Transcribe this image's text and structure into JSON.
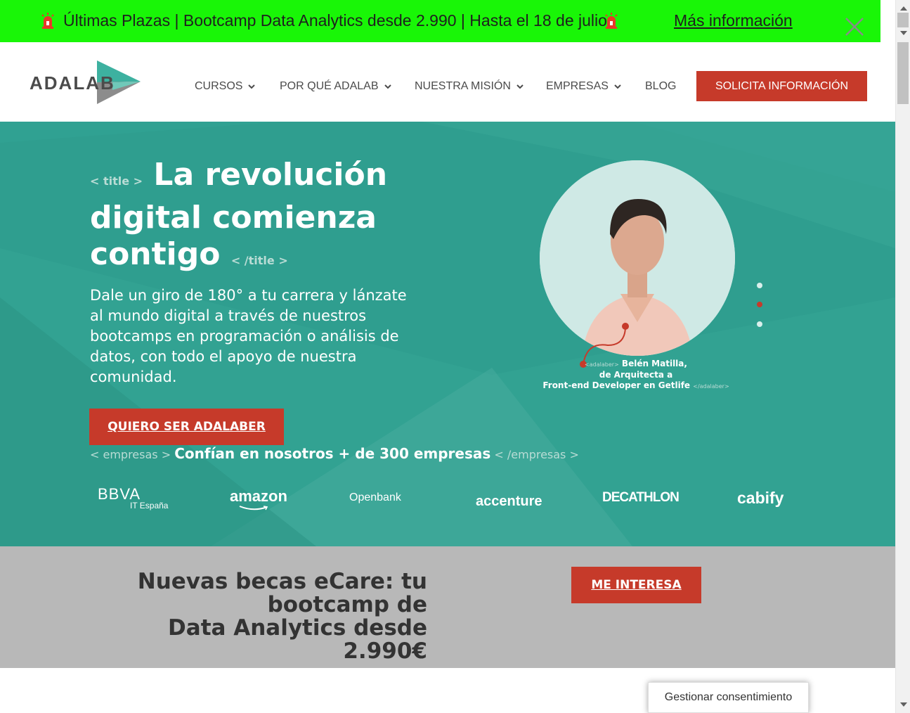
{
  "promo": {
    "text": "Últimas Plazas | Bootcamp Data Analytics desde 2.990 | Hasta el 18 de julio",
    "link": "Más información",
    "icons": [
      "siren-icon",
      "siren-icon",
      "close-icon"
    ],
    "background": "#19f607"
  },
  "header": {
    "logo": "ADALAB",
    "nav": [
      {
        "label": "CURSOS",
        "dropdown": true
      },
      {
        "label": "POR QUÉ ADALAB",
        "dropdown": true
      },
      {
        "label": "NUESTRA MISIÓN",
        "dropdown": true
      },
      {
        "label": "EMPRESAS",
        "dropdown": true
      },
      {
        "label": "BLOG",
        "dropdown": false
      }
    ],
    "cta": "SOLICITA INFORMACIÓN"
  },
  "hero": {
    "tag_open": "< title >",
    "title": "La revolución digital comienza contigo",
    "tag_close": "< /title >",
    "description": "Dale un giro de 180° a tu carrera y lánzate al mundo digital a través de nuestros bootcamps en programación o análisis de datos, con todo el apoyo de nuestra comunidad.",
    "cta": "QUIERO SER ADALABER",
    "companies_open": "< empresas >",
    "companies_text": "Confían en nosotros + de 300 empresas",
    "companies_close": "< /empresas >",
    "brands": [
      "BBVA",
      "IT España",
      "amazon",
      "Openbank",
      "accenture",
      "DECATHLON",
      "cabify"
    ],
    "caption": {
      "tag_open": "<adalaber>",
      "line1": "Belén Matilla,",
      "line2": "de Arquitecta a",
      "line3": "Front-end Developer en Getlife",
      "tag_close": "</adalaber>"
    },
    "slider": {
      "count": 3,
      "active": 2
    },
    "colors": {
      "background": "#30a192",
      "accent": "#c63a2a"
    }
  },
  "becas": {
    "line1": "Nuevas becas eCare: tu bootcamp de",
    "line2": "Data Analytics desde 2.990€",
    "cta": "ME INTERESA"
  },
  "consent": {
    "label": "Gestionar consentimiento"
  }
}
